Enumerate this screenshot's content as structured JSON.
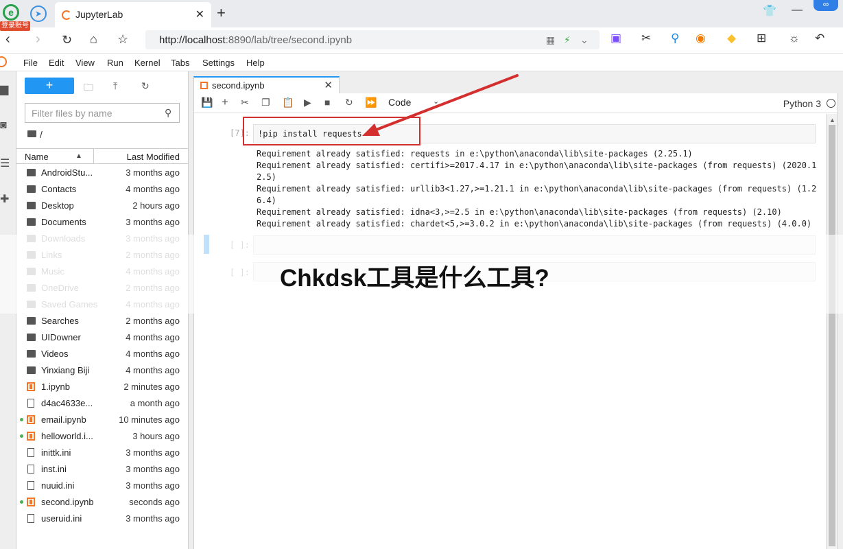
{
  "browser": {
    "logo_glyph": "e",
    "login_badge": "登录账号",
    "tab_title": "JupyterLab",
    "url_host": "http://localhost",
    "url_rest": ":8890/lab/tree/second.ipynb"
  },
  "menu": [
    "File",
    "Edit",
    "View",
    "Run",
    "Kernel",
    "Tabs",
    "Settings",
    "Help"
  ],
  "filebrowser": {
    "filter_placeholder": "Filter files by name",
    "breadcrumb": "/",
    "col_name": "Name",
    "col_modified": "Last Modified",
    "items": [
      {
        "name": "AndroidStu...",
        "modified": "3 months ago",
        "type": "folder",
        "hidden": false,
        "running": false
      },
      {
        "name": "Contacts",
        "modified": "4 months ago",
        "type": "folder",
        "hidden": false,
        "running": false
      },
      {
        "name": "Desktop",
        "modified": "2 hours ago",
        "type": "folder",
        "hidden": false,
        "running": false
      },
      {
        "name": "Documents",
        "modified": "3 months ago",
        "type": "folder",
        "hidden": false,
        "running": false
      },
      {
        "name": "Downloads",
        "modified": "3 months ago",
        "type": "folder",
        "hidden": true,
        "running": false
      },
      {
        "name": "Links",
        "modified": "2 months ago",
        "type": "folder",
        "hidden": true,
        "running": false
      },
      {
        "name": "Music",
        "modified": "4 months ago",
        "type": "folder",
        "hidden": true,
        "running": false
      },
      {
        "name": "OneDrive",
        "modified": "2 months ago",
        "type": "folder",
        "hidden": true,
        "running": false
      },
      {
        "name": "Saved Games",
        "modified": "4 months ago",
        "type": "folder",
        "hidden": true,
        "running": false
      },
      {
        "name": "Searches",
        "modified": "2 months ago",
        "type": "folder",
        "hidden": false,
        "running": false
      },
      {
        "name": "UIDowner",
        "modified": "4 months ago",
        "type": "folder",
        "hidden": false,
        "running": false
      },
      {
        "name": "Videos",
        "modified": "4 months ago",
        "type": "folder",
        "hidden": false,
        "running": false
      },
      {
        "name": "Yinxiang Biji",
        "modified": "4 months ago",
        "type": "folder",
        "hidden": false,
        "running": false
      },
      {
        "name": "1.ipynb",
        "modified": "2 minutes ago",
        "type": "notebook",
        "hidden": false,
        "running": false
      },
      {
        "name": "d4ac4633e...",
        "modified": "a month ago",
        "type": "file",
        "hidden": false,
        "running": false
      },
      {
        "name": "email.ipynb",
        "modified": "10 minutes ago",
        "type": "notebook",
        "hidden": false,
        "running": true
      },
      {
        "name": "helloworld.i...",
        "modified": "3 hours ago",
        "type": "notebook",
        "hidden": false,
        "running": true
      },
      {
        "name": "inittk.ini",
        "modified": "3 months ago",
        "type": "file",
        "hidden": false,
        "running": false
      },
      {
        "name": "inst.ini",
        "modified": "3 months ago",
        "type": "file",
        "hidden": false,
        "running": false
      },
      {
        "name": "nuuid.ini",
        "modified": "3 months ago",
        "type": "file",
        "hidden": false,
        "running": false
      },
      {
        "name": "second.ipynb",
        "modified": "seconds ago",
        "type": "notebook",
        "hidden": false,
        "running": true
      },
      {
        "name": "useruid.ini",
        "modified": "3 months ago",
        "type": "file",
        "hidden": false,
        "running": false
      }
    ]
  },
  "notebook": {
    "tab_label": "second.ipynb",
    "cell_type": "Code",
    "kernel": "Python 3",
    "cells": [
      {
        "prompt": "[7]:",
        "source": "!pip install requests",
        "output": [
          "Requirement already satisfied: requests in e:\\python\\anaconda\\lib\\site-packages (2.25.1)",
          "Requirement already satisfied: certifi>=2017.4.17 in e:\\python\\anaconda\\lib\\site-packages (from requests) (2020.1",
          "2.5)",
          "Requirement already satisfied: urllib3<1.27,>=1.21.1 in e:\\python\\anaconda\\lib\\site-packages (from requests) (1.2",
          "6.4)",
          "Requirement already satisfied: idna<3,>=2.5 in e:\\python\\anaconda\\lib\\site-packages (from requests) (2.10)",
          "Requirement already satisfied: chardet<5,>=3.0.2 in e:\\python\\anaconda\\lib\\site-packages (from requests) (4.0.0)"
        ]
      },
      {
        "prompt": "[ ]:",
        "source": ""
      },
      {
        "prompt": "[ ]:",
        "source": ""
      }
    ]
  },
  "overlay": {
    "title": "Chkdsk工具是什么工具?",
    "annotation_color": "#d32f2f"
  },
  "colors": {
    "accent": "#2196f3",
    "jupyter_orange": "#f37626",
    "running_dot": "#4caf50"
  }
}
